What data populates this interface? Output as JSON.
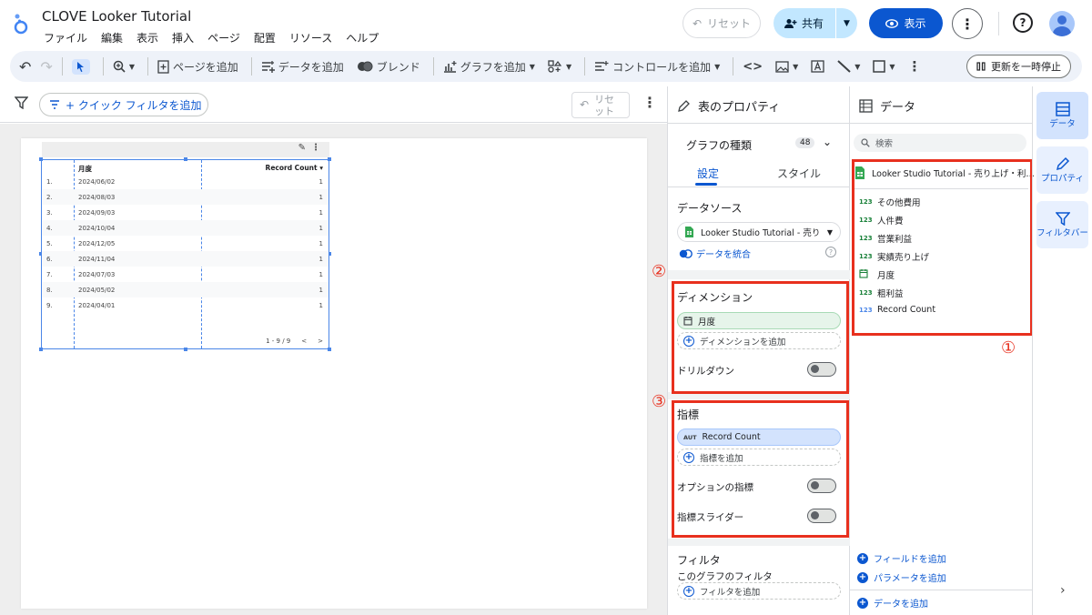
{
  "app": {
    "title": "CLOVE Looker Tutorial",
    "menu": [
      "ファイル",
      "編集",
      "表示",
      "挿入",
      "ページ",
      "配置",
      "リソース",
      "ヘルプ"
    ],
    "reset_label": "リセット",
    "share_label": "共有",
    "view_label": "表示",
    "accent": "#0b57d0",
    "highlight": "#e8301e"
  },
  "toolbar": {
    "add_page": "ページを追加",
    "add_data": "データを追加",
    "blend": "ブレンド",
    "add_chart": "グラフを追加",
    "add_control": "コントロールを追加",
    "pause_updates": "更新を一時停止"
  },
  "filterbar": {
    "quick_filter": "+ クイック フィルタを追加",
    "reset_line1": "リセ",
    "reset_line2": "ット"
  },
  "table": {
    "col_dimension": "月度",
    "col_metric": "Record Count",
    "rows": [
      {
        "n": "1.",
        "date": "2024/06/02",
        "value": "1"
      },
      {
        "n": "2.",
        "date": "2024/08/03",
        "value": "1"
      },
      {
        "n": "3.",
        "date": "2024/09/03",
        "value": "1"
      },
      {
        "n": "4.",
        "date": "2024/10/04",
        "value": "1"
      },
      {
        "n": "5.",
        "date": "2024/12/05",
        "value": "1"
      },
      {
        "n": "6.",
        "date": "2024/11/04",
        "value": "1"
      },
      {
        "n": "7.",
        "date": "2024/07/03",
        "value": "1"
      },
      {
        "n": "8.",
        "date": "2024/05/02",
        "value": "1"
      },
      {
        "n": "9.",
        "date": "2024/04/01",
        "value": "1"
      }
    ],
    "pager": "1 - 9 / 9"
  },
  "props": {
    "title": "表のプロパティ",
    "chart_type": "グラフの種類",
    "chart_type_count": "48",
    "tab_setup": "設定",
    "tab_style": "スタイル",
    "datasource_heading": "データソース",
    "datasource_value": "Looker Studio Tutorial - 売り…",
    "blend_data": "データを統合",
    "dimension_heading": "ディメンション",
    "dimension_value": "月度",
    "add_dimension": "ディメンションを追加",
    "drilldown": "ドリルダウン",
    "metric_heading": "指標",
    "metric_badge": "AUT",
    "metric_value": "Record Count",
    "add_metric": "指標を追加",
    "optional_metrics": "オプションの指標",
    "metric_slider": "指標スライダー",
    "filter_heading": "フィルタ",
    "chart_filter": "このグラフのフィルタ",
    "add_filter": "フィルタを追加"
  },
  "data": {
    "title": "データ",
    "search_placeholder": "検索",
    "source_name": "Looker Studio Tutorial - 売り上げ・利…",
    "fields": [
      {
        "type": "123",
        "name": "その他費用"
      },
      {
        "type": "123",
        "name": "人件費"
      },
      {
        "type": "123",
        "name": "営業利益"
      },
      {
        "type": "123",
        "name": "実績売り上げ"
      },
      {
        "type": "cal",
        "name": "月度"
      },
      {
        "type": "123",
        "name": "粗利益"
      },
      {
        "type": "123",
        "name": "Record Count"
      }
    ],
    "add_field": "フィールドを追加",
    "add_parameter": "パラメータを追加",
    "add_data": "データを追加"
  },
  "rail": {
    "data": "データ",
    "properties": "プロパティ",
    "filter_bar": "フィルタバー"
  },
  "annotations": [
    "①",
    "②",
    "③"
  ]
}
